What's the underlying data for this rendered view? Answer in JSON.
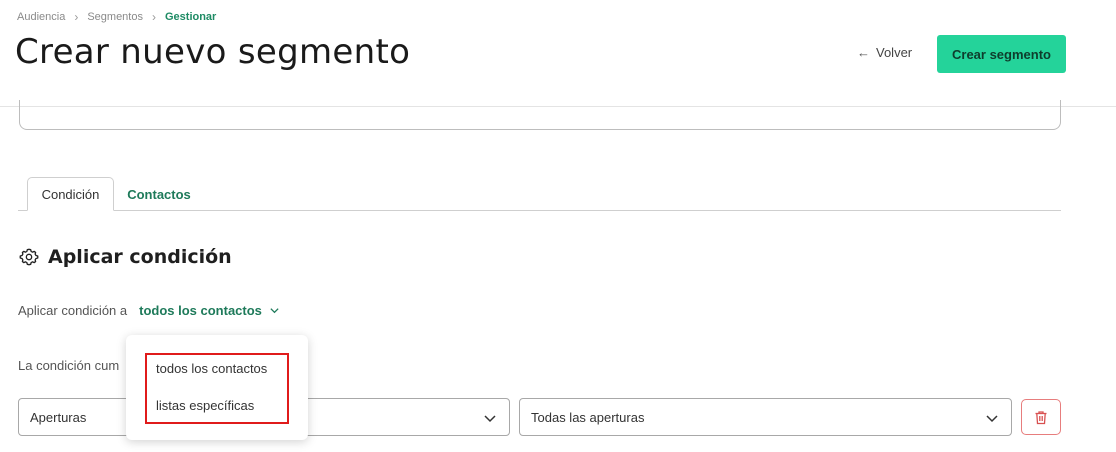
{
  "breadcrumb": {
    "items": [
      "Audiencia",
      "Segmentos"
    ],
    "current": "Gestionar",
    "separator": ">"
  },
  "header": {
    "title": "Crear nuevo segmento",
    "back_label": "Volver",
    "primary_label": "Crear segmento"
  },
  "tabs": [
    {
      "label": "Condición",
      "active": true
    },
    {
      "label": "Contactos",
      "active": false
    }
  ],
  "section": {
    "title": "Aplicar condición"
  },
  "apply": {
    "label": "Aplicar condición a",
    "selected": "todos los contactos"
  },
  "condition": {
    "label_visible": "La condición cum"
  },
  "selects": {
    "metric": "Aperturas",
    "scope": "Todas las aperturas"
  },
  "dropdown": {
    "options": [
      "todos los contactos",
      "listas específicas"
    ]
  },
  "colors": {
    "accent": "#24d39a",
    "link_green": "#1e7a5a",
    "danger": "#e77d7d",
    "highlight_red": "#e01b1b"
  }
}
